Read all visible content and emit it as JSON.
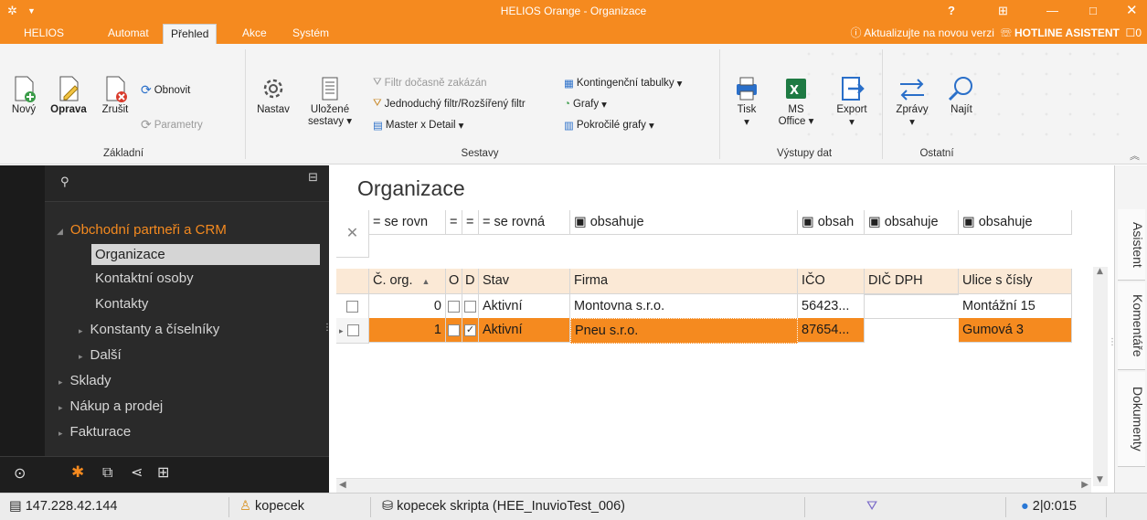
{
  "window": {
    "title": "HELIOS Orange - Organizace",
    "help": "?"
  },
  "menu_tabs": [
    "HELIOS",
    "Automat",
    "Přehled",
    "Akce",
    "Systém"
  ],
  "active_tab": "Přehled",
  "topright": {
    "update": "Aktualizujte na novou verzi",
    "hotline": "HOTLINE ASISTENT",
    "count": "0"
  },
  "ribbon": {
    "zakladni": {
      "novy": "Nový",
      "oprava": "Oprava",
      "zrusit": "Zrušit",
      "obnovit": "Obnovit",
      "parametry": "Parametry",
      "group": "Základní"
    },
    "sestavy": {
      "nastav": "Nastav",
      "ulozene1": "Uložené",
      "ulozene2": "sestavy",
      "filtr_disabled": "Filtr dočasně zakázán",
      "jednoduchy": "Jednoduchý filtr/Rozšířený filtr",
      "master": "Master x Detail",
      "kontingencni": "Kontingenční tabulky",
      "grafy": "Grafy",
      "pokrocile": "Pokročilé grafy",
      "group": "Sestavy"
    },
    "vystupy": {
      "tisk": "Tisk",
      "ms1": "MS",
      "ms2": "Office",
      "export": "Export",
      "group": "Výstupy dat"
    },
    "ostatni": {
      "zpravy": "Zprávy",
      "najit": "Najít",
      "group": "Ostatní"
    }
  },
  "nav": {
    "items": [
      {
        "label": "Obchodní partneři a CRM",
        "level": 0,
        "expanded": true
      },
      {
        "label": "Organizace",
        "level": 1,
        "selected": true
      },
      {
        "label": "Kontaktní osoby",
        "level": 1
      },
      {
        "label": "Kontakty",
        "level": 1
      },
      {
        "label": "Konstanty a číselníky",
        "level": 1,
        "collapsed": true
      },
      {
        "label": "Další",
        "level": 1,
        "collapsed": true
      },
      {
        "label": "Sklady",
        "level": 0
      },
      {
        "label": "Nákup a prodej",
        "level": 0
      },
      {
        "label": "Fakturace",
        "level": 0
      }
    ]
  },
  "main": {
    "title": "Organizace",
    "filters": [
      "= se rovn",
      "=",
      "=",
      "= se rovná",
      "▣ obsahuje",
      "▣ obsah",
      "▣ obsahuje",
      "▣ obsahuje"
    ],
    "columns": [
      "Č. org.",
      "O",
      "D",
      "Stav",
      "Firma",
      "IČO",
      "DIČ DPH",
      "Ulice s čísly"
    ],
    "rows": [
      {
        "cislo": "0",
        "o": false,
        "d": false,
        "stav": "Aktivní",
        "firma": "Montovna s.r.o.",
        "ico": "56423...",
        "dic": "",
        "ulice": "Montážní 15",
        "selected": false
      },
      {
        "cislo": "1",
        "o": false,
        "d": true,
        "stav": "Aktivní",
        "firma": "Pneu s.r.o.",
        "ico": "87654...",
        "dic": "",
        "ulice": "Gumová 3",
        "selected": true
      }
    ]
  },
  "rail": [
    "Asistent",
    "Komentáře",
    "Dokumenty"
  ],
  "status": {
    "ip": "147.228.42.144",
    "user": "kopecek",
    "db": "kopecek skripta (HEE_InuvioTest_006)",
    "counter": "2|0:015"
  },
  "colors": {
    "accent": "#f58a1f",
    "nav_bg": "#2a2a2a",
    "header_bg": "#fbe9d6"
  }
}
